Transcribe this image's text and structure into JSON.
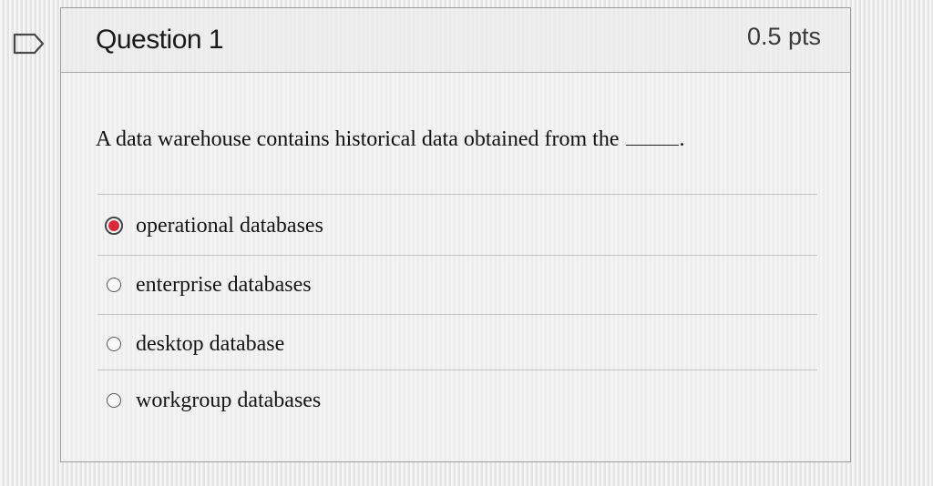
{
  "question": {
    "title": "Question 1",
    "points": "0.5 pts",
    "text": "A data warehouse contains historical data obtained from the",
    "text_end": "."
  },
  "options": [
    {
      "label": "operational databases",
      "selected": true
    },
    {
      "label": "enterprise databases",
      "selected": false
    },
    {
      "label": "desktop database",
      "selected": false
    },
    {
      "label": "workgroup databases",
      "selected": false
    }
  ],
  "colors": {
    "selected_radio": "#d8283a",
    "card_border": "#9c9c9c"
  },
  "icons": {
    "flag": "flag-icon"
  }
}
